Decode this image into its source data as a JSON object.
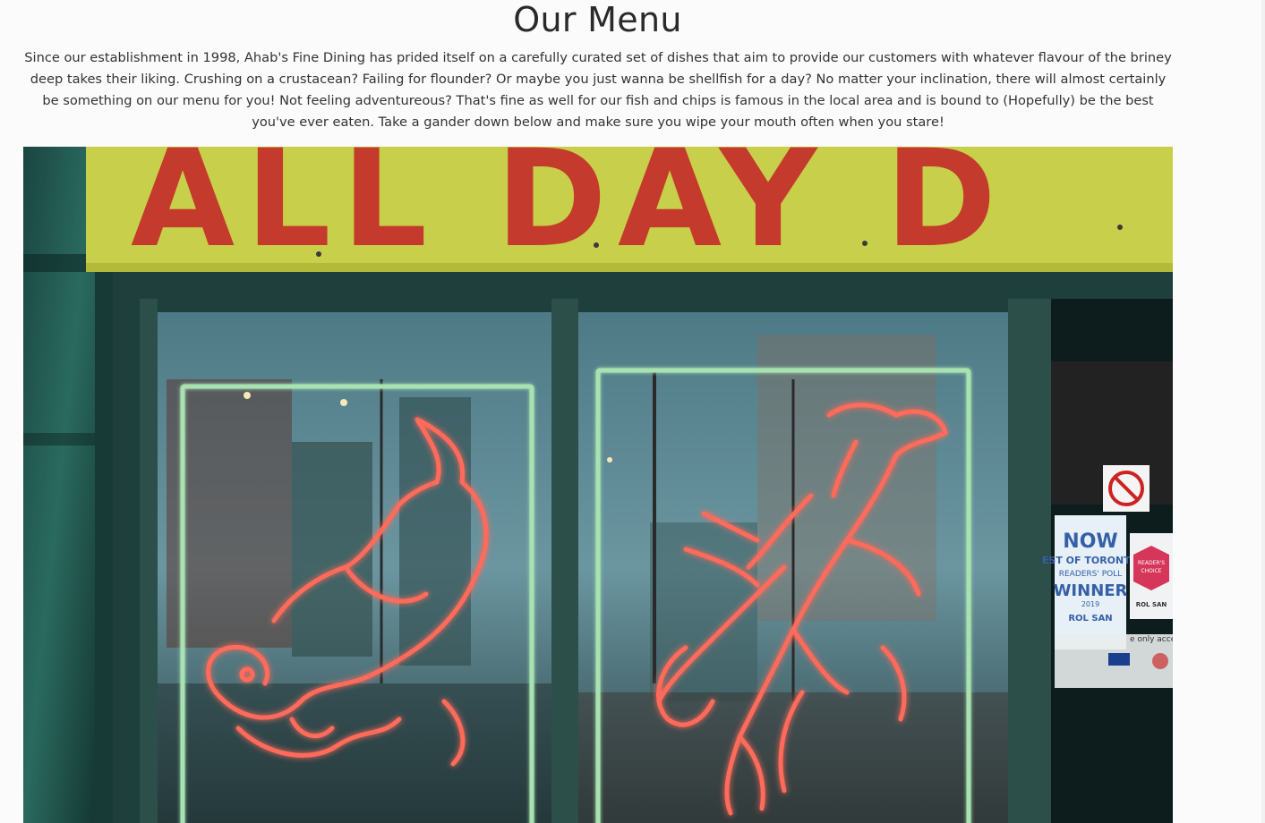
{
  "main": {
    "title": "Our Menu",
    "intro": "Since our establishment in 1998, Ahab's Fine Dining has prided itself on a carefully curated set of dishes that aim to provide our customers with whatever flavour of the briney deep takes their liking. Crushing on a crustacean? Failing for flounder? Or maybe you just wanna be shellfish for a day? No matter your inclination, there will almost certainly be something on our menu for you! Not feeling adventureous? That's fine as well for our fish and chips is famous in the local area and is bound to (Hopefully) be the best you've ever eaten. Take a gander down below and make sure you wipe your mouth often when you stare!"
  },
  "hero_image": {
    "banner_text": "ALL DAY D",
    "poster_lines": [
      "NOW",
      "EST OF TORONTO",
      "READERS' POLL",
      "WINNER",
      "2019",
      "ROL SAN"
    ],
    "badge_lines": [
      "READER'S",
      "CHOICE",
      "ROL SAN"
    ],
    "notice_text": "e only accep",
    "colors": {
      "banner": "#c8cf4a",
      "banner_text": "#c43a2c",
      "neon": "#ff6b5a",
      "neon_glow": "#ff3b2f",
      "frame": "#a8e2b0",
      "teal": "#1d4a46",
      "window": "#6b96a0"
    }
  }
}
